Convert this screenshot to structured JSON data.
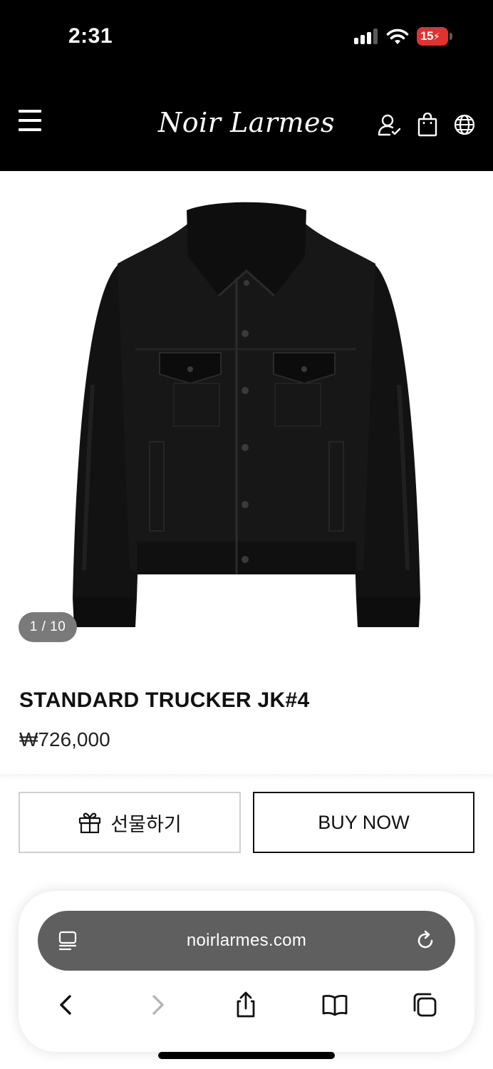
{
  "status_bar": {
    "time": "2:31",
    "battery_level": "15",
    "battery_color": "#e0322f"
  },
  "header": {
    "logo": "Noir Larmes",
    "icons": [
      "menu-icon",
      "user-icon",
      "shopping-bag-icon",
      "globe-icon"
    ]
  },
  "gallery": {
    "image_icon": "leather-jacket-image",
    "counter": "1 / 10"
  },
  "product": {
    "title": "STANDARD TRUCKER JK#4",
    "price": "₩726,000"
  },
  "actions": {
    "gift_label": "선물하기",
    "buy_label": "BUY NOW"
  },
  "browser": {
    "url": "noirlarmes.com",
    "icons": [
      "reader-icon",
      "reload-icon",
      "back-icon",
      "forward-icon",
      "share-icon",
      "bookmarks-icon",
      "tabs-icon"
    ]
  }
}
